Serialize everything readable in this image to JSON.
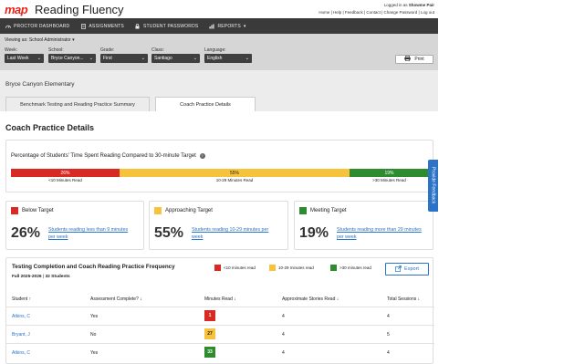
{
  "brand": {
    "map": "map",
    "product": "Reading Fluency"
  },
  "account": {
    "logged_in_prefix": "Logged in as",
    "user": "Showme Pair",
    "links": "Home | Help | Feedback | Contact | Change Password | Log out"
  },
  "nav": [
    {
      "label": "PROCTOR DASHBOARD",
      "icon": "gauge-icon"
    },
    {
      "label": "ASSIGNMENTS",
      "icon": "document-icon"
    },
    {
      "label": "STUDENT PASSWORDS",
      "icon": "lock-icon"
    },
    {
      "label": "REPORTS",
      "icon": "chart-icon"
    }
  ],
  "filters": {
    "viewing": "Viewing as: School Administrator",
    "week": {
      "label": "Week:",
      "value": "Last Week"
    },
    "school": {
      "label": "School:",
      "value": "Bryce Canyon..."
    },
    "grade": {
      "label": "Grade:",
      "value": "First"
    },
    "class": {
      "label": "Class:",
      "value": "Santiago"
    },
    "language": {
      "label": "Language:",
      "value": "English"
    },
    "print": "Print"
  },
  "school_name": "Bryce Canyon Elementary",
  "tabs": [
    "Benchmark Testing and Reading Practice Summary",
    "Coach Practice Details"
  ],
  "page_title": "Coach Practice Details",
  "colors": {
    "red": "#d82a23",
    "yellow": "#f8c33c",
    "green": "#2e8b2e",
    "link": "#2a73c6"
  },
  "chart_data": {
    "type": "bar",
    "title": "Percentage of Students' Time Spent Reading Compared to 30-minute Target",
    "stacked": true,
    "categories": [
      "<10 Minutes Read",
      "10-29 Minutes Read",
      ">30 Minutes Read"
    ],
    "values": [
      26,
      55,
      19
    ],
    "value_labels": [
      "26%",
      "55%",
      "19%"
    ],
    "colors": [
      "#d82a23",
      "#f8c33c",
      "#2e8b2e"
    ]
  },
  "categories": [
    {
      "title": "Below Target",
      "pct": "26%",
      "desc": "Students reading less than 9 minutes per week"
    },
    {
      "title": "Approaching Target",
      "pct": "55%",
      "desc": "Students reading 10-29 minutes per week"
    },
    {
      "title": "Meeting Target",
      "pct": "19%",
      "desc": "Students reading more than 29 minutes per week"
    }
  ],
  "table": {
    "title": "Testing Completion and Coach Reading Practice Frequency",
    "term": "Fall 2025-2026",
    "count": "32 Students",
    "legend": [
      "<10 minutes read",
      "10-29 minutes read",
      ">30 minutes read"
    ],
    "export": "Export",
    "headers": [
      "Student",
      "Assessment Complete?",
      "Minutes Read",
      "Approximate Stories Read",
      "Total Sessions"
    ],
    "rows": [
      {
        "student": "Atkins, C",
        "complete": "Yes",
        "minutes": "1",
        "stories": "4",
        "sessions": "4"
      },
      {
        "student": "Bryant, J",
        "complete": "No",
        "minutes": "27",
        "stories": "4",
        "sessions": "5"
      },
      {
        "student": "Atkins, C",
        "complete": "Yes",
        "minutes": "33",
        "stories": "4",
        "sessions": "4"
      }
    ]
  },
  "feedback": "Provide Feedback"
}
